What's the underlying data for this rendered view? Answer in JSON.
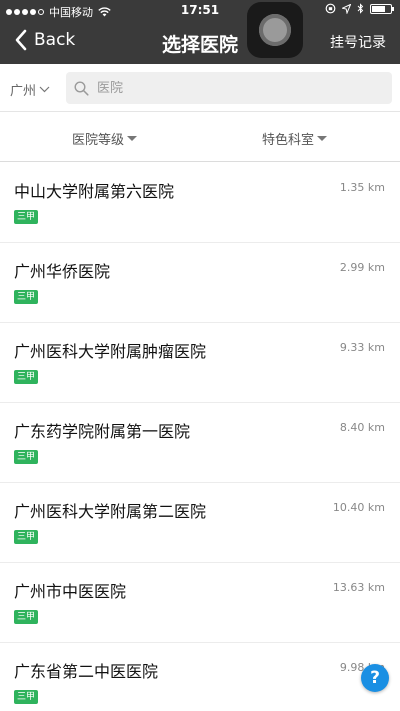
{
  "status_bar": {
    "carrier": "中国移动",
    "time": "17:51",
    "battery_level": 0.7
  },
  "nav": {
    "back_label": "Back",
    "title": "选择医院",
    "right_label": "挂号记录"
  },
  "search": {
    "city": "广州",
    "placeholder": "医院"
  },
  "filters": [
    {
      "label": "医院等级"
    },
    {
      "label": "特色科室"
    }
  ],
  "hospitals": [
    {
      "name": "中山大学附属第六医院",
      "distance": "1.35 km",
      "grade": "三甲"
    },
    {
      "name": "广州华侨医院",
      "distance": "2.99 km",
      "grade": "三甲"
    },
    {
      "name": "广州医科大学附属肿瘤医院",
      "distance": "9.33 km",
      "grade": "三甲"
    },
    {
      "name": "广东药学院附属第一医院",
      "distance": "8.40 km",
      "grade": "三甲"
    },
    {
      "name": "广州医科大学附属第二医院",
      "distance": "10.40 km",
      "grade": "三甲"
    },
    {
      "name": "广州市中医医院",
      "distance": "13.63 km",
      "grade": "三甲"
    },
    {
      "name": "广东省第二中医医院",
      "distance": "9.98 km",
      "grade": "三甲"
    }
  ],
  "help_label": "?",
  "colors": {
    "header_bg": "#3a3a3a",
    "badge_green": "#2fb35d",
    "help_blue": "#1a8fe3"
  }
}
